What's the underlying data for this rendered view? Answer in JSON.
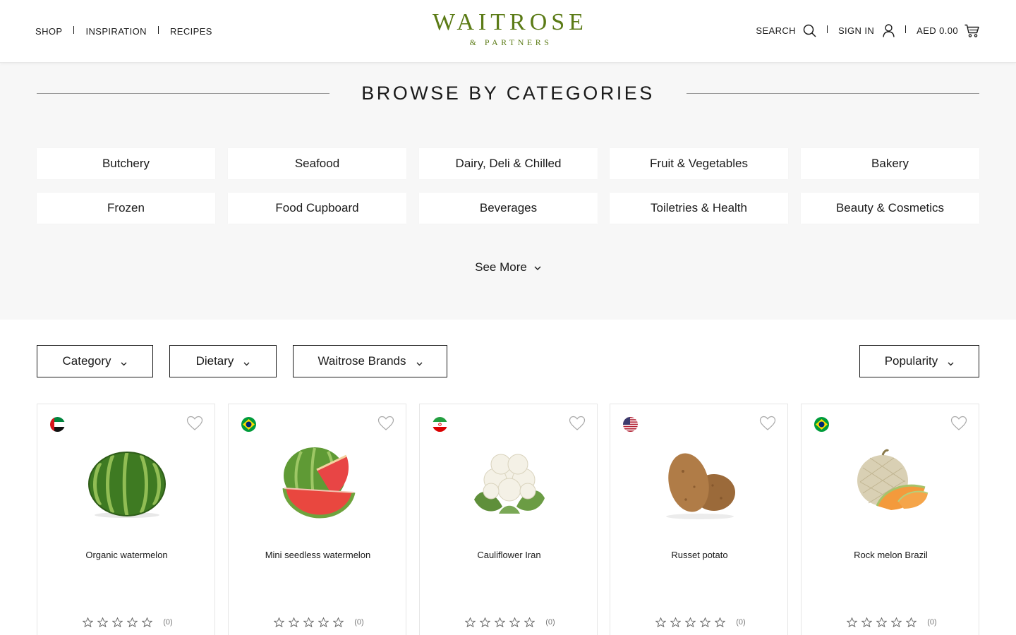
{
  "header": {
    "nav_left": [
      {
        "label": "SHOP"
      },
      {
        "label": "INSPIRATION"
      },
      {
        "label": "RECIPES"
      }
    ],
    "logo": {
      "main": "WAITROSE",
      "sub": "& PARTNERS",
      "color": "#5b7b16"
    },
    "search_label": "SEARCH",
    "signin_label": "SIGN IN",
    "cart_label": "AED 0.00"
  },
  "browse": {
    "title": "BROWSE BY CATEGORIES",
    "categories": [
      "Butchery",
      "Seafood",
      "Dairy, Deli & Chilled",
      "Fruit & Vegetables",
      "Bakery",
      "Frozen",
      "Food Cupboard",
      "Beverages",
      "Toiletries & Health",
      "Beauty & Cosmetics"
    ],
    "see_more": "See More"
  },
  "filters": {
    "category": "Category",
    "dietary": "Dietary",
    "brands": "Waitrose Brands",
    "sort": "Popularity"
  },
  "products": [
    {
      "name": "Organic watermelon",
      "flag": "uae-flag-icon",
      "image": "watermelon-image",
      "rating_count": "(0)",
      "rating": 0
    },
    {
      "name": "Mini seedless watermelon",
      "flag": "brazil-flag-icon",
      "image": "cut-watermelon-image",
      "rating_count": "(0)",
      "rating": 0
    },
    {
      "name": "Cauliflower Iran",
      "flag": "iran-flag-icon",
      "image": "cauliflower-image",
      "rating_count": "(0)",
      "rating": 0
    },
    {
      "name": "Russet potato",
      "flag": "usa-flag-icon",
      "image": "potato-image",
      "rating_count": "(0)",
      "rating": 0
    },
    {
      "name": "Rock melon Brazil",
      "flag": "brazil-flag-icon",
      "image": "rock-melon-image",
      "rating_count": "(0)",
      "rating": 0
    }
  ]
}
